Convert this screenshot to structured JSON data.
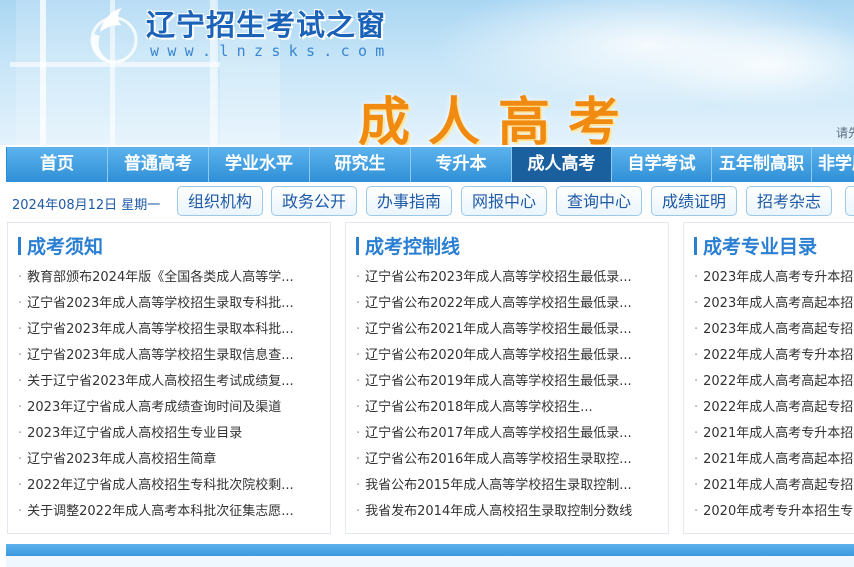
{
  "site": {
    "title": "辽宁招生考试之窗",
    "url": "www.lnzsks.com",
    "section_title": "成人高考",
    "login_hint": "请先"
  },
  "colors": {
    "nav_bg": "#2f8fd6",
    "nav_active": "#1a5f9e",
    "section_title": "#f08a10",
    "heading": "#2b7fd3"
  },
  "nav": {
    "items": [
      {
        "label": "首页"
      },
      {
        "label": "普通高考"
      },
      {
        "label": "学业水平"
      },
      {
        "label": "研究生"
      },
      {
        "label": "专升本"
      },
      {
        "label": "成人高考"
      },
      {
        "label": "自学考试"
      },
      {
        "label": "五年制高职"
      },
      {
        "label": "非学历"
      }
    ],
    "active": "成人高考"
  },
  "subbar": {
    "date": "2024年08月12日 星期一",
    "buttons": [
      {
        "label": "组织机构"
      },
      {
        "label": "政务公开"
      },
      {
        "label": "办事指南"
      },
      {
        "label": "网报中心"
      },
      {
        "label": "查询中心"
      },
      {
        "label": "成绩证明"
      },
      {
        "label": "招考杂志"
      }
    ]
  },
  "columns": [
    {
      "title": "成考须知",
      "items": [
        "教育部颁布2024年版《全国各类成人高等学...",
        "辽宁省2023年成人高等学校招生录取专科批...",
        "辽宁省2023年成人高等学校招生录取本科批...",
        "辽宁省2023年成人高等学校招生录取信息查...",
        "关于辽宁省2023年成人高校招生考试成绩复...",
        "2023年辽宁省成人高考成绩查询时间及渠道",
        "2023年辽宁省成人高校招生专业目录",
        "辽宁省2023年成人高校招生简章",
        "2022年辽宁省成人高校招生专科批次院校剩...",
        "关于调整2022年成人高考本科批次征集志愿..."
      ]
    },
    {
      "title": "成考控制线",
      "items": [
        "辽宁省公布2023年成人高等学校招生最低录...",
        "辽宁省公布2022年成人高等学校招生最低录...",
        "辽宁省公布2021年成人高等学校招生最低录...",
        "辽宁省公布2020年成人高等学校招生最低录...",
        "辽宁省公布2019年成人高等学校招生最低录...",
        "辽宁省公布2018年成人高等学校招生...",
        "辽宁省公布2017年成人高等学校招生最低录...",
        "辽宁省公布2016年成人高等学校招生录取控...",
        "我省公布2015年成人高等学校招生录取控制...",
        "我省发布2014年成人高校招生录取控制分数线"
      ]
    },
    {
      "title": "成考专业目录",
      "items": [
        "2023年成人高考专升本招",
        "2023年成人高考高起本招",
        "2023年成人高考高起专招",
        "2022年成人高考专升本招",
        "2022年成人高考高起本招",
        "2022年成人高考高起专招",
        "2021年成人高考专升本招",
        "2021年成人高考高起本招",
        "2021年成人高考高起专招",
        "2020年成考专升本招生专"
      ]
    }
  ]
}
